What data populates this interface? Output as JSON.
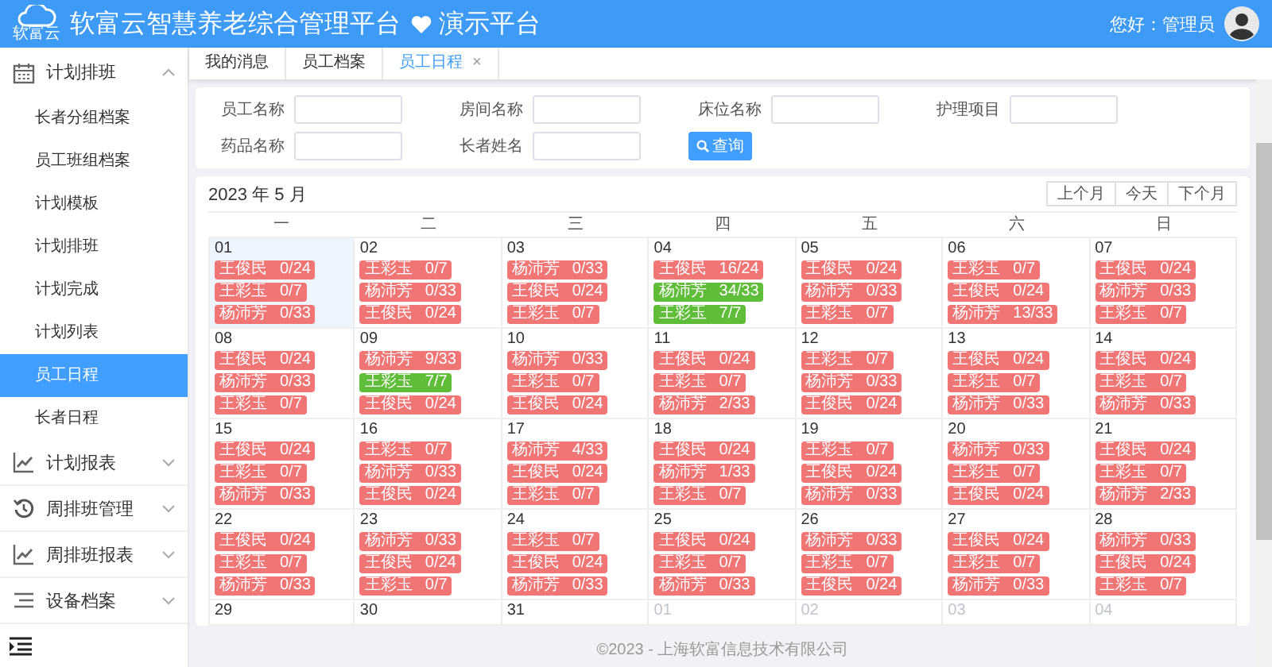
{
  "header": {
    "logo_text": "软富云",
    "title": "软富云智慧养老综合管理平台",
    "subtitle": "演示平台",
    "greeting": "您好：管理员"
  },
  "sidebar": {
    "groups": [
      {
        "label": "计划排班",
        "expanded": true,
        "items": [
          {
            "label": "长者分组档案",
            "selected": false
          },
          {
            "label": "员工班组档案",
            "selected": false
          },
          {
            "label": "计划模板",
            "selected": false
          },
          {
            "label": "计划排班",
            "selected": false
          },
          {
            "label": "计划完成",
            "selected": false
          },
          {
            "label": "计划列表",
            "selected": false
          },
          {
            "label": "员工日程",
            "selected": true
          },
          {
            "label": "长者日程",
            "selected": false
          }
        ]
      },
      {
        "label": "计划报表",
        "expanded": false
      },
      {
        "label": "周排班管理",
        "expanded": false
      },
      {
        "label": "周排班报表",
        "expanded": false
      },
      {
        "label": "设备档案",
        "expanded": false
      }
    ]
  },
  "tabs": [
    {
      "label": "我的消息",
      "selected": false
    },
    {
      "label": "员工档案",
      "selected": false
    },
    {
      "label": "员工日程",
      "selected": true,
      "close": "×"
    }
  ],
  "filters": [
    {
      "label": "员工名称"
    },
    {
      "label": "房间名称"
    },
    {
      "label": "床位名称"
    },
    {
      "label": "护理项目"
    },
    {
      "label": "药品名称"
    },
    {
      "label": "长者姓名"
    }
  ],
  "search_button": "查询",
  "calendar": {
    "title": "2023 年 5 月",
    "buttons": [
      "上个月",
      "今天",
      "下个月"
    ],
    "weekdays": [
      "一",
      "二",
      "三",
      "四",
      "五",
      "六",
      "日"
    ],
    "weeks": [
      [
        {
          "day": "01",
          "today": true,
          "other_month": false,
          "entries": [
            {
              "name": "王俊民",
              "count": "0/24",
              "complete": false
            },
            {
              "name": "王彩玉",
              "count": "0/7",
              "complete": false
            },
            {
              "name": "杨沛芳",
              "count": "0/33",
              "complete": false
            }
          ]
        },
        {
          "day": "02",
          "today": false,
          "other_month": false,
          "entries": [
            {
              "name": "王彩玉",
              "count": "0/7",
              "complete": false
            },
            {
              "name": "杨沛芳",
              "count": "0/33",
              "complete": false
            },
            {
              "name": "王俊民",
              "count": "0/24",
              "complete": false
            }
          ]
        },
        {
          "day": "03",
          "today": false,
          "other_month": false,
          "entries": [
            {
              "name": "杨沛芳",
              "count": "0/33",
              "complete": false
            },
            {
              "name": "王俊民",
              "count": "0/24",
              "complete": false
            },
            {
              "name": "王彩玉",
              "count": "0/7",
              "complete": false
            }
          ]
        },
        {
          "day": "04",
          "today": false,
          "other_month": false,
          "entries": [
            {
              "name": "王俊民",
              "count": "16/24",
              "complete": false
            },
            {
              "name": "杨沛芳",
              "count": "34/33",
              "complete": true
            },
            {
              "name": "王彩玉",
              "count": "7/7",
              "complete": true
            }
          ]
        },
        {
          "day": "05",
          "today": false,
          "other_month": false,
          "entries": [
            {
              "name": "王俊民",
              "count": "0/24",
              "complete": false
            },
            {
              "name": "杨沛芳",
              "count": "0/33",
              "complete": false
            },
            {
              "name": "王彩玉",
              "count": "0/7",
              "complete": false
            }
          ]
        },
        {
          "day": "06",
          "today": false,
          "other_month": false,
          "entries": [
            {
              "name": "王彩玉",
              "count": "0/7",
              "complete": false
            },
            {
              "name": "王俊民",
              "count": "0/24",
              "complete": false
            },
            {
              "name": "杨沛芳",
              "count": "13/33",
              "complete": false
            }
          ]
        },
        {
          "day": "07",
          "today": false,
          "other_month": false,
          "entries": [
            {
              "name": "王俊民",
              "count": "0/24",
              "complete": false
            },
            {
              "name": "杨沛芳",
              "count": "0/33",
              "complete": false
            },
            {
              "name": "王彩玉",
              "count": "0/7",
              "complete": false
            }
          ]
        }
      ],
      [
        {
          "day": "08",
          "today": false,
          "other_month": false,
          "entries": [
            {
              "name": "王俊民",
              "count": "0/24",
              "complete": false
            },
            {
              "name": "杨沛芳",
              "count": "0/33",
              "complete": false
            },
            {
              "name": "王彩玉",
              "count": "0/7",
              "complete": false
            }
          ]
        },
        {
          "day": "09",
          "today": false,
          "other_month": false,
          "entries": [
            {
              "name": "杨沛芳",
              "count": "9/33",
              "complete": false
            },
            {
              "name": "王彩玉",
              "count": "7/7",
              "complete": true
            },
            {
              "name": "王俊民",
              "count": "0/24",
              "complete": false
            }
          ]
        },
        {
          "day": "10",
          "today": false,
          "other_month": false,
          "entries": [
            {
              "name": "杨沛芳",
              "count": "0/33",
              "complete": false
            },
            {
              "name": "王彩玉",
              "count": "0/7",
              "complete": false
            },
            {
              "name": "王俊民",
              "count": "0/24",
              "complete": false
            }
          ]
        },
        {
          "day": "11",
          "today": false,
          "other_month": false,
          "entries": [
            {
              "name": "王俊民",
              "count": "0/24",
              "complete": false
            },
            {
              "name": "王彩玉",
              "count": "0/7",
              "complete": false
            },
            {
              "name": "杨沛芳",
              "count": "2/33",
              "complete": false
            }
          ]
        },
        {
          "day": "12",
          "today": false,
          "other_month": false,
          "entries": [
            {
              "name": "王彩玉",
              "count": "0/7",
              "complete": false
            },
            {
              "name": "杨沛芳",
              "count": "0/33",
              "complete": false
            },
            {
              "name": "王俊民",
              "count": "0/24",
              "complete": false
            }
          ]
        },
        {
          "day": "13",
          "today": false,
          "other_month": false,
          "entries": [
            {
              "name": "王俊民",
              "count": "0/24",
              "complete": false
            },
            {
              "name": "王彩玉",
              "count": "0/7",
              "complete": false
            },
            {
              "name": "杨沛芳",
              "count": "0/33",
              "complete": false
            }
          ]
        },
        {
          "day": "14",
          "today": false,
          "other_month": false,
          "entries": [
            {
              "name": "王俊民",
              "count": "0/24",
              "complete": false
            },
            {
              "name": "王彩玉",
              "count": "0/7",
              "complete": false
            },
            {
              "name": "杨沛芳",
              "count": "0/33",
              "complete": false
            }
          ]
        }
      ],
      [
        {
          "day": "15",
          "today": false,
          "other_month": false,
          "entries": [
            {
              "name": "王俊民",
              "count": "0/24",
              "complete": false
            },
            {
              "name": "王彩玉",
              "count": "0/7",
              "complete": false
            },
            {
              "name": "杨沛芳",
              "count": "0/33",
              "complete": false
            }
          ]
        },
        {
          "day": "16",
          "today": false,
          "other_month": false,
          "entries": [
            {
              "name": "王彩玉",
              "count": "0/7",
              "complete": false
            },
            {
              "name": "杨沛芳",
              "count": "0/33",
              "complete": false
            },
            {
              "name": "王俊民",
              "count": "0/24",
              "complete": false
            }
          ]
        },
        {
          "day": "17",
          "today": false,
          "other_month": false,
          "entries": [
            {
              "name": "杨沛芳",
              "count": "4/33",
              "complete": false
            },
            {
              "name": "王俊民",
              "count": "0/24",
              "complete": false
            },
            {
              "name": "王彩玉",
              "count": "0/7",
              "complete": false
            }
          ]
        },
        {
          "day": "18",
          "today": false,
          "other_month": false,
          "entries": [
            {
              "name": "王俊民",
              "count": "0/24",
              "complete": false
            },
            {
              "name": "杨沛芳",
              "count": "1/33",
              "complete": false
            },
            {
              "name": "王彩玉",
              "count": "0/7",
              "complete": false
            }
          ]
        },
        {
          "day": "19",
          "today": false,
          "other_month": false,
          "entries": [
            {
              "name": "王彩玉",
              "count": "0/7",
              "complete": false
            },
            {
              "name": "王俊民",
              "count": "0/24",
              "complete": false
            },
            {
              "name": "杨沛芳",
              "count": "0/33",
              "complete": false
            }
          ]
        },
        {
          "day": "20",
          "today": false,
          "other_month": false,
          "entries": [
            {
              "name": "杨沛芳",
              "count": "0/33",
              "complete": false
            },
            {
              "name": "王彩玉",
              "count": "0/7",
              "complete": false
            },
            {
              "name": "王俊民",
              "count": "0/24",
              "complete": false
            }
          ]
        },
        {
          "day": "21",
          "today": false,
          "other_month": false,
          "entries": [
            {
              "name": "王俊民",
              "count": "0/24",
              "complete": false
            },
            {
              "name": "王彩玉",
              "count": "0/7",
              "complete": false
            },
            {
              "name": "杨沛芳",
              "count": "2/33",
              "complete": false
            }
          ]
        }
      ],
      [
        {
          "day": "22",
          "today": false,
          "other_month": false,
          "entries": [
            {
              "name": "王俊民",
              "count": "0/24",
              "complete": false
            },
            {
              "name": "王彩玉",
              "count": "0/7",
              "complete": false
            },
            {
              "name": "杨沛芳",
              "count": "0/33",
              "complete": false
            }
          ]
        },
        {
          "day": "23",
          "today": false,
          "other_month": false,
          "entries": [
            {
              "name": "杨沛芳",
              "count": "0/33",
              "complete": false
            },
            {
              "name": "王俊民",
              "count": "0/24",
              "complete": false
            },
            {
              "name": "王彩玉",
              "count": "0/7",
              "complete": false
            }
          ]
        },
        {
          "day": "24",
          "today": false,
          "other_month": false,
          "entries": [
            {
              "name": "王彩玉",
              "count": "0/7",
              "complete": false
            },
            {
              "name": "王俊民",
              "count": "0/24",
              "complete": false
            },
            {
              "name": "杨沛芳",
              "count": "0/33",
              "complete": false
            }
          ]
        },
        {
          "day": "25",
          "today": false,
          "other_month": false,
          "entries": [
            {
              "name": "王俊民",
              "count": "0/24",
              "complete": false
            },
            {
              "name": "王彩玉",
              "count": "0/7",
              "complete": false
            },
            {
              "name": "杨沛芳",
              "count": "0/33",
              "complete": false
            }
          ]
        },
        {
          "day": "26",
          "today": false,
          "other_month": false,
          "entries": [
            {
              "name": "杨沛芳",
              "count": "0/33",
              "complete": false
            },
            {
              "name": "王彩玉",
              "count": "0/7",
              "complete": false
            },
            {
              "name": "王俊民",
              "count": "0/24",
              "complete": false
            }
          ]
        },
        {
          "day": "27",
          "today": false,
          "other_month": false,
          "entries": [
            {
              "name": "王俊民",
              "count": "0/24",
              "complete": false
            },
            {
              "name": "王彩玉",
              "count": "0/7",
              "complete": false
            },
            {
              "name": "杨沛芳",
              "count": "0/33",
              "complete": false
            }
          ]
        },
        {
          "day": "28",
          "today": false,
          "other_month": false,
          "entries": [
            {
              "name": "杨沛芳",
              "count": "0/33",
              "complete": false
            },
            {
              "name": "王俊民",
              "count": "0/24",
              "complete": false
            },
            {
              "name": "王彩玉",
              "count": "0/7",
              "complete": false
            }
          ]
        }
      ],
      [
        {
          "day": "29",
          "today": false,
          "other_month": false
        },
        {
          "day": "30",
          "today": false,
          "other_month": false
        },
        {
          "day": "31",
          "today": false,
          "other_month": false
        },
        {
          "day": "01",
          "today": false,
          "other_month": true
        },
        {
          "day": "02",
          "today": false,
          "other_month": true
        },
        {
          "day": "03",
          "today": false,
          "other_month": true
        },
        {
          "day": "04",
          "today": false,
          "other_month": true
        }
      ]
    ]
  },
  "footer": "©2023 - 上海软富信息技术有限公司"
}
